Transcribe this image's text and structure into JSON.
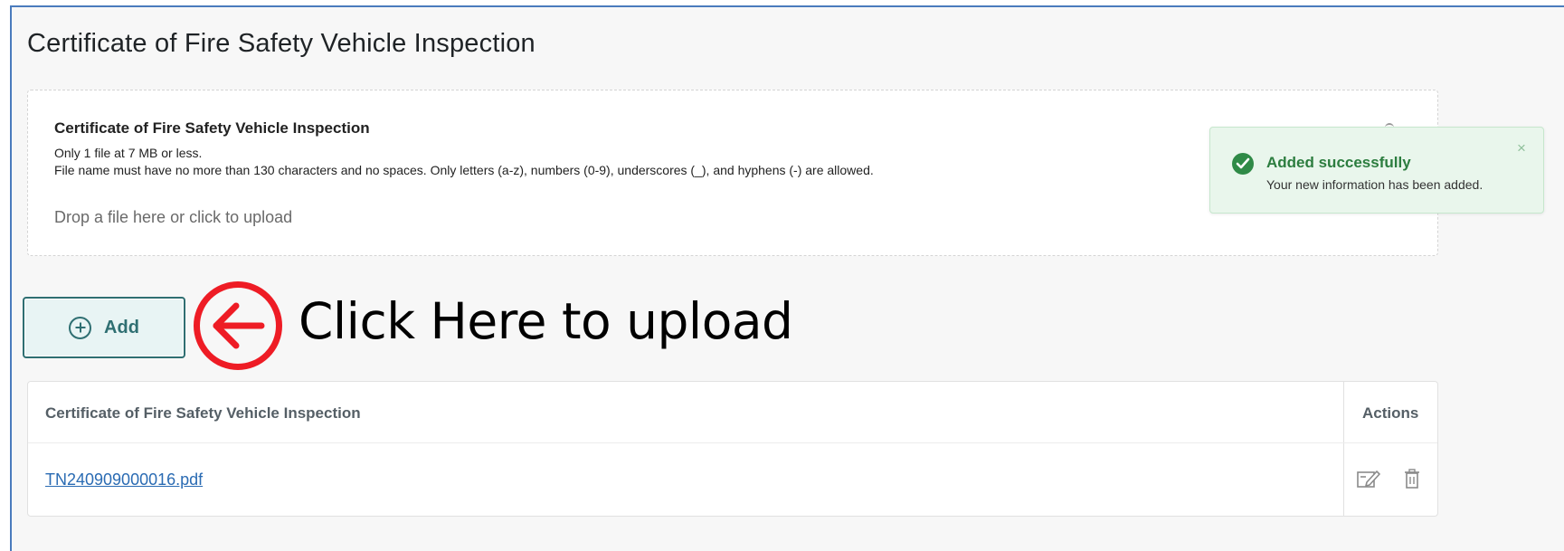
{
  "page": {
    "title": "Certificate of Fire Safety Vehicle Inspection"
  },
  "upload": {
    "title": "Certificate of Fire Safety Vehicle Inspection",
    "rule_1": "Only 1 file at 7 MB or less.",
    "rule_2": "File name must have no more than 130 characters and no spaces. Only letters (a-z), numbers (0-9), underscores (_), and hyphens (-) are allowed.",
    "drop_text": "Drop a file here or click to upload"
  },
  "add_button": {
    "label": "Add",
    "icon": "plus-circle-icon"
  },
  "annotation": {
    "text": "Click Here to upload",
    "color": "#ee1c25",
    "icon": "left-arrow-icon"
  },
  "table": {
    "columns": [
      "Certificate of Fire Safety Vehicle Inspection",
      "Actions"
    ],
    "rows": [
      {
        "file": "TN240909000016.pdf",
        "actions": [
          "edit-icon",
          "trash-icon"
        ]
      }
    ]
  },
  "toast": {
    "title": "Added successfully",
    "message": "Your new information has been added.",
    "status_color": "#2f8a47",
    "icon": "check-circle-icon"
  },
  "colors": {
    "accent": "#2f6f72",
    "link": "#2a6bb3",
    "frame_border": "#4a7bbd"
  }
}
